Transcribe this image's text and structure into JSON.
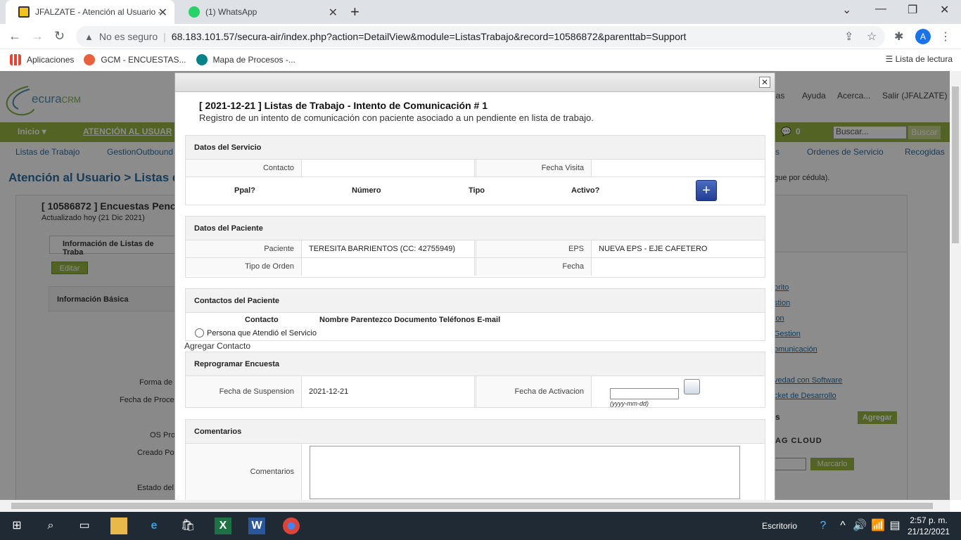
{
  "browser": {
    "tabs": [
      {
        "title": "JFALZATE - Atención al Usuario -"
      },
      {
        "title": "(1) WhatsApp"
      }
    ],
    "not_secure": "No es seguro",
    "url": "68.183.101.57/secura-air/index.php?action=DetailView&module=ListasTrabajo&record=10586872&parenttab=Support",
    "avatar_letter": "A",
    "bookmarks": [
      "Aplicaciones",
      "GCM - ENCUESTAS...",
      "Mapa de Procesos -..."
    ],
    "reading_list": "Lista de lectura"
  },
  "app": {
    "logo": "ecura",
    "logo_suffix": "CRM",
    "top_links": [
      "ias",
      "Ayuda",
      "Acerca...",
      "Salir (JFALZATE)"
    ],
    "menu": {
      "inicio": "Inicio",
      "section": "ATENCIÓN AL USUAR",
      "count": "0",
      "search_placeholder": "Buscar...",
      "search_btn": "Buscar"
    },
    "subnav": [
      "Listas de Trabajo",
      "GestionOutbound",
      "s",
      "Ordenes de Servicio",
      "Recogidas"
    ],
    "breadcrumb": "Atención al Usuario > Listas de",
    "record_title": "[ 10586872 ] Encuestas Penc",
    "record_updated": "Actualizado hoy (21 Dic 2021)",
    "tab_info": "Información de Listas de Traba",
    "editar": "Editar",
    "basic_info": "Información Básica",
    "field_labels": [
      "Forma de",
      "Fecha de Proce",
      "OS Pro",
      "Creado Po",
      "Estado del"
    ],
    "right_hint": "gue por cédula).",
    "right_links": [
      "orito",
      "stion",
      "ion",
      "Gestion",
      "omunicación",
      "vedad con Software",
      "cket de Desarrollo"
    ],
    "right_s": "s",
    "agregar": "Agregar",
    "tag_cloud": "AG CLOUD",
    "marcarlo": "Marcarlo"
  },
  "modal": {
    "title": "[ 2021-12-21 ] Listas de Trabajo - Intento de Comunicación # 1",
    "subtitle": "Registro de un intento de comunicación con paciente asociado a un pendiente en lista de trabajo.",
    "servicio": {
      "header": "Datos del Servicio",
      "contacto_label": "Contacto",
      "contacto_value": "",
      "fecha_visita_label": "Fecha Visita",
      "fecha_visita_value": "",
      "cols": [
        "Ppal?",
        "Número",
        "Tipo",
        "Activo?"
      ]
    },
    "paciente": {
      "header": "Datos del Paciente",
      "paciente_label": "Paciente",
      "paciente_value": "TERESITA BARRIENTOS (CC: 42755949)",
      "eps_label": "EPS",
      "eps_value": "NUEVA EPS - EJE CAFETERO",
      "tipo_orden_label": "Tipo de Orden",
      "tipo_orden_value": "",
      "fecha_label": "Fecha",
      "fecha_value": ""
    },
    "contactos": {
      "header": "Contactos del Paciente",
      "cols": "Contacto",
      "cols_rest": "Nombre Parentezco Documento Teléfonos E-mail",
      "radio_label": "Persona que Atendió el Servicio",
      "agregar_contacto": "Agregar Contacto"
    },
    "reprogramar": {
      "header": "Reprogramar Encuesta",
      "suspension_label": "Fecha de Suspension",
      "suspension_value": "2021-12-21",
      "activacion_label": "Fecha de Activacion",
      "activacion_value": "",
      "date_hint": "(yyyy-mm-dd)"
    },
    "comentarios": {
      "header": "Comentarios",
      "label": "Comentarios"
    }
  },
  "taskbar": {
    "desktop": "Escritorio",
    "time": "2:57 p. m.",
    "date": "21/12/2021"
  },
  "colors": {
    "accent": "#95b540",
    "link": "#2c6e9e"
  }
}
